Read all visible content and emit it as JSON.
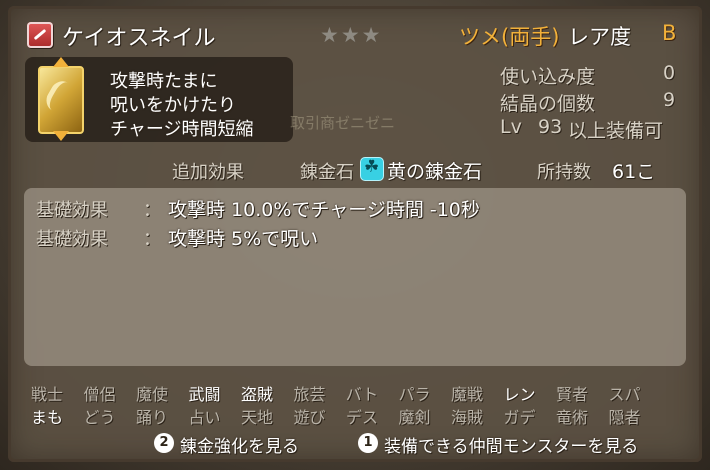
{
  "item": {
    "name": "ケイオスネイル",
    "stars": "★★★",
    "type": "ツメ(両手)",
    "rarity_label": "レア度",
    "rarity": "B",
    "summary": [
      "攻撃時たまに",
      "呪いをかけたり",
      "チャージ時間短縮"
    ]
  },
  "stats": [
    {
      "label": "使い込み度",
      "value": "0"
    },
    {
      "label": "結晶の個数",
      "value": "9"
    },
    {
      "label": "Lv",
      "level": "93",
      "suffix": "以上装備可"
    }
  ],
  "background_text": "取引商ゼニゼニ",
  "extra": {
    "label": "追加効果",
    "stone_label": "錬金石",
    "stone_name": "黄の錬金石",
    "owned_label": "所持数",
    "owned_value": "61こ"
  },
  "effects": [
    {
      "label": "基礎効果",
      "sep": "：",
      "text": "攻撃時 10.0%でチャージ時間 -10秒"
    },
    {
      "label": "基礎効果",
      "sep": "：",
      "text": "攻撃時 5%で呪い"
    }
  ],
  "jobs_row1": [
    {
      "name": "戦士",
      "on": false
    },
    {
      "name": "僧侶",
      "on": false
    },
    {
      "name": "魔使",
      "on": false
    },
    {
      "name": "武闘",
      "on": true
    },
    {
      "name": "盗賊",
      "on": true
    },
    {
      "name": "旅芸",
      "on": false
    },
    {
      "name": "バト",
      "on": false
    },
    {
      "name": "パラ",
      "on": false
    },
    {
      "name": "魔戦",
      "on": false
    },
    {
      "name": "レン",
      "on": true
    },
    {
      "name": "賢者",
      "on": false
    },
    {
      "name": "スパ",
      "on": false
    }
  ],
  "jobs_row2": [
    {
      "name": "まも",
      "on": true
    },
    {
      "name": "どう",
      "on": false
    },
    {
      "name": "踊り",
      "on": false
    },
    {
      "name": "占い",
      "on": false
    },
    {
      "name": "天地",
      "on": false
    },
    {
      "name": "遊び",
      "on": false
    },
    {
      "name": "デス",
      "on": false
    },
    {
      "name": "魔剣",
      "on": false
    },
    {
      "name": "海賊",
      "on": false
    },
    {
      "name": "ガデ",
      "on": false
    },
    {
      "name": "竜術",
      "on": false
    },
    {
      "name": "隠者",
      "on": false
    }
  ],
  "footer": [
    {
      "key": "2",
      "label": "錬金強化を見る"
    },
    {
      "key": "1",
      "label": "装備できる仲間モンスターを見る"
    }
  ]
}
